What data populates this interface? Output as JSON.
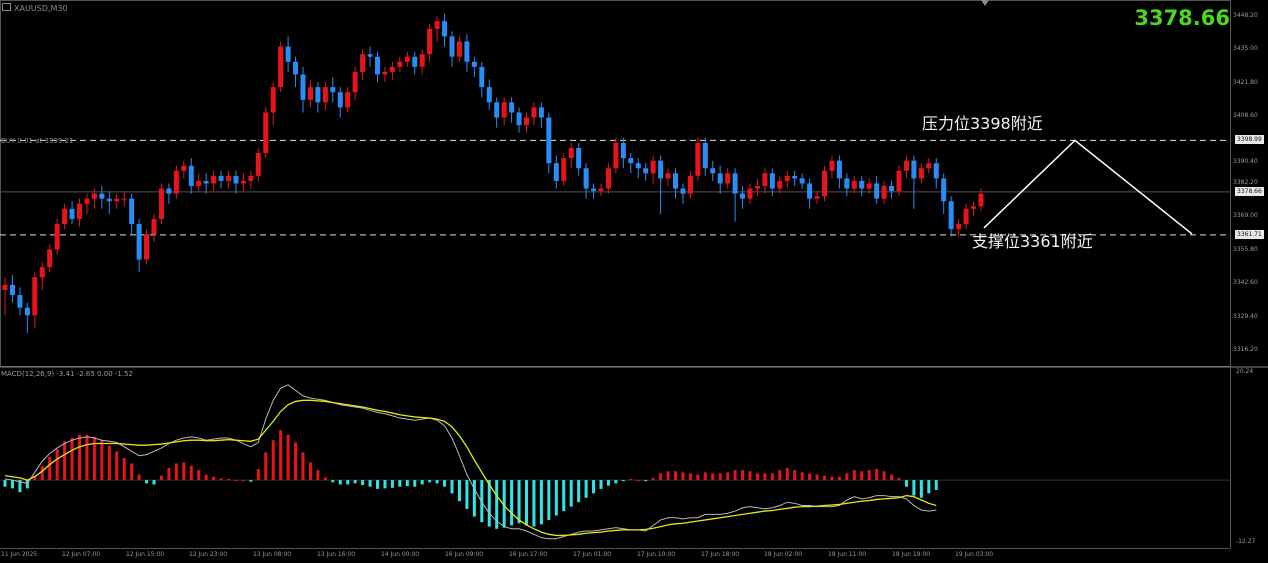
{
  "header": {
    "symbol_label": "XAUUSD,M30",
    "last_price_big": "3378.66"
  },
  "order_label": "BUY 0.01 at 3399.21",
  "annotations": {
    "resistance": "压力位3398附近",
    "support": "支撑位3361附近"
  },
  "macd_label": "MACD(12,26,9) -3.41 -2.65 0.00 -1.52",
  "colors": {
    "background": "#000000",
    "bull": "#e8141c",
    "bear": "#2a8cf5",
    "macd_pos": "#e8141c",
    "macd_neg": "#2fe6e6",
    "signal": "#e6e61a",
    "macd_line": "#b8b8b8",
    "last_price": "#4cd622"
  },
  "icons": {
    "symbol": "chart-window-icon",
    "scroll_marker": "triangle-down-icon"
  },
  "price_axis": [
    "3448.20",
    "3435.00",
    "3421.80",
    "3408.60",
    "3382.20",
    "3369.00",
    "3355.80",
    "3342.60",
    "3329.40",
    "3316.20"
  ],
  "price_tags": {
    "resistance": "3398.99",
    "current": "3378.66",
    "support": "3361.71",
    "order": "3390.40"
  },
  "macd_axis": [
    "20.24",
    "-12.27"
  ],
  "time_axis": [
    "11 Jun 2025",
    "12 Jun 07:00",
    "12 Jun 15:00",
    "12 Jun 23:00",
    "13 Jun 08:00",
    "13 Jun 16:00",
    "14 Jun 00:00",
    "16 Jun 09:00",
    "16 Jun 17:00",
    "17 Jun 01:00",
    "17 Jun 10:00",
    "17 Jun 18:00",
    "18 Jun 02:00",
    "18 Jun 11:00",
    "18 Jun 19:00",
    "19 Jun 03:00"
  ],
  "chart_data": {
    "type": "candlestick",
    "price_ylim": [
      3310,
      3452
    ],
    "macd_ylim": [
      -12.27,
      20.24
    ],
    "levels": {
      "resistance": 3398.99,
      "support": 3361.71,
      "current": 3378.66
    },
    "candles": [
      [
        3340,
        3342,
        3330,
        3345
      ],
      [
        3342,
        3338,
        3335,
        3346
      ],
      [
        3338,
        3333,
        3330,
        3341
      ],
      [
        3333,
        3330,
        3323,
        3335
      ],
      [
        3330,
        3345,
        3325,
        3347
      ],
      [
        3345,
        3349,
        3340,
        3351
      ],
      [
        3349,
        3356,
        3347,
        3358
      ],
      [
        3356,
        3366,
        3354,
        3368
      ],
      [
        3366,
        3372,
        3364,
        3374
      ],
      [
        3372,
        3368,
        3366,
        3375
      ],
      [
        3368,
        3374,
        3365,
        3376
      ],
      [
        3374,
        3376,
        3370,
        3378
      ],
      [
        3376,
        3378,
        3372,
        3380
      ],
      [
        3378,
        3376,
        3372,
        3381
      ],
      [
        3376,
        3375,
        3370,
        3379
      ],
      [
        3375,
        3376,
        3372,
        3378
      ],
      [
        3376,
        3376,
        3373,
        3379
      ],
      [
        3376,
        3366,
        3362,
        3378
      ],
      [
        3366,
        3352,
        3347,
        3368
      ],
      [
        3352,
        3362,
        3350,
        3364
      ],
      [
        3362,
        3368,
        3359,
        3370
      ],
      [
        3368,
        3380,
        3366,
        3382
      ],
      [
        3380,
        3378,
        3374,
        3382
      ],
      [
        3378,
        3387,
        3376,
        3389
      ],
      [
        3387,
        3389,
        3384,
        3391
      ],
      [
        3389,
        3381,
        3378,
        3392
      ],
      [
        3381,
        3383,
        3379,
        3386
      ],
      [
        3383,
        3382,
        3378,
        3386
      ],
      [
        3382,
        3385,
        3379,
        3387
      ],
      [
        3385,
        3383,
        3380,
        3387
      ],
      [
        3383,
        3385,
        3380,
        3387
      ],
      [
        3385,
        3382,
        3378,
        3387
      ],
      [
        3382,
        3383,
        3379,
        3386
      ],
      [
        3383,
        3385,
        3380,
        3387
      ],
      [
        3385,
        3394,
        3383,
        3396
      ],
      [
        3394,
        3410,
        3392,
        3412
      ],
      [
        3410,
        3420,
        3405,
        3422
      ],
      [
        3420,
        3436,
        3418,
        3438
      ],
      [
        3436,
        3430,
        3426,
        3440
      ],
      [
        3430,
        3425,
        3420,
        3432
      ],
      [
        3425,
        3415,
        3410,
        3428
      ],
      [
        3415,
        3420,
        3412,
        3423
      ],
      [
        3420,
        3414,
        3410,
        3422
      ],
      [
        3414,
        3420,
        3411,
        3422
      ],
      [
        3420,
        3418,
        3414,
        3424
      ],
      [
        3418,
        3412,
        3408,
        3420
      ],
      [
        3412,
        3418,
        3410,
        3420
      ],
      [
        3418,
        3426,
        3415,
        3428
      ],
      [
        3426,
        3433,
        3423,
        3435
      ],
      [
        3433,
        3432,
        3428,
        3436
      ],
      [
        3432,
        3425,
        3422,
        3434
      ],
      [
        3425,
        3426,
        3422,
        3428
      ],
      [
        3426,
        3428,
        3423,
        3430
      ],
      [
        3428,
        3430,
        3426,
        3432
      ],
      [
        3430,
        3432,
        3428,
        3434
      ],
      [
        3432,
        3428,
        3425,
        3434
      ],
      [
        3428,
        3433,
        3425,
        3435
      ],
      [
        3433,
        3443,
        3430,
        3445
      ],
      [
        3443,
        3446,
        3438,
        3448
      ],
      [
        3446,
        3440,
        3436,
        3449
      ],
      [
        3440,
        3432,
        3428,
        3442
      ],
      [
        3432,
        3438,
        3430,
        3440
      ],
      [
        3438,
        3430,
        3426,
        3441
      ],
      [
        3430,
        3428,
        3424,
        3432
      ],
      [
        3428,
        3420,
        3416,
        3430
      ],
      [
        3420,
        3414,
        3411,
        3423
      ],
      [
        3414,
        3408,
        3404,
        3416
      ],
      [
        3408,
        3414,
        3405,
        3416
      ],
      [
        3414,
        3410,
        3406,
        3416
      ],
      [
        3410,
        3405,
        3402,
        3412
      ],
      [
        3405,
        3408,
        3402,
        3410
      ],
      [
        3408,
        3412,
        3405,
        3414
      ],
      [
        3412,
        3408,
        3404,
        3414
      ],
      [
        3408,
        3390,
        3386,
        3410
      ],
      [
        3390,
        3383,
        3380,
        3393
      ],
      [
        3383,
        3392,
        3381,
        3394
      ],
      [
        3392,
        3396,
        3388,
        3398
      ],
      [
        3396,
        3388,
        3385,
        3398
      ],
      [
        3388,
        3380,
        3376,
        3390
      ],
      [
        3380,
        3379,
        3376,
        3382
      ],
      [
        3379,
        3380,
        3377,
        3382
      ],
      [
        3380,
        3388,
        3378,
        3390
      ],
      [
        3388,
        3398,
        3386,
        3400
      ],
      [
        3398,
        3392,
        3388,
        3400
      ],
      [
        3392,
        3390,
        3386,
        3394
      ],
      [
        3390,
        3388,
        3384,
        3392
      ],
      [
        3388,
        3386,
        3383,
        3390
      ],
      [
        3386,
        3391,
        3382,
        3393
      ],
      [
        3391,
        3384,
        3370,
        3393
      ],
      [
        3384,
        3386,
        3381,
        3388
      ],
      [
        3386,
        3380,
        3376,
        3388
      ],
      [
        3380,
        3378,
        3374,
        3382
      ],
      [
        3378,
        3385,
        3376,
        3387
      ],
      [
        3385,
        3398,
        3383,
        3400
      ],
      [
        3398,
        3388,
        3385,
        3400
      ],
      [
        3388,
        3386,
        3383,
        3391
      ],
      [
        3386,
        3382,
        3378,
        3389
      ],
      [
        3382,
        3386,
        3380,
        3388
      ],
      [
        3386,
        3378,
        3367,
        3388
      ],
      [
        3378,
        3376,
        3372,
        3381
      ],
      [
        3376,
        3380,
        3374,
        3382
      ],
      [
        3380,
        3381,
        3377,
        3384
      ],
      [
        3381,
        3386,
        3378,
        3388
      ],
      [
        3386,
        3380,
        3377,
        3388
      ],
      [
        3380,
        3383,
        3378,
        3385
      ],
      [
        3383,
        3385,
        3380,
        3387
      ],
      [
        3385,
        3384,
        3381,
        3387
      ],
      [
        3384,
        3382,
        3380,
        3386
      ],
      [
        3382,
        3376,
        3372,
        3384
      ],
      [
        3376,
        3377,
        3374,
        3379
      ],
      [
        3377,
        3387,
        3375,
        3389
      ],
      [
        3387,
        3391,
        3384,
        3393
      ],
      [
        3391,
        3384,
        3380,
        3393
      ],
      [
        3384,
        3380,
        3377,
        3386
      ],
      [
        3380,
        3383,
        3378,
        3385
      ],
      [
        3383,
        3380,
        3377,
        3385
      ],
      [
        3380,
        3382,
        3378,
        3384
      ],
      [
        3382,
        3376,
        3374,
        3385
      ],
      [
        3376,
        3381,
        3374,
        3383
      ],
      [
        3381,
        3379,
        3376,
        3383
      ],
      [
        3379,
        3387,
        3377,
        3389
      ],
      [
        3387,
        3391,
        3384,
        3393
      ],
      [
        3391,
        3384,
        3372,
        3393
      ],
      [
        3384,
        3388,
        3382,
        3390
      ],
      [
        3388,
        3390,
        3386,
        3392
      ],
      [
        3390,
        3384,
        3380,
        3392
      ],
      [
        3384,
        3375,
        3370,
        3386
      ],
      [
        3375,
        3364,
        3361,
        3377
      ],
      [
        3364,
        3366,
        3361,
        3368
      ],
      [
        3366,
        3372,
        3364,
        3374
      ],
      [
        3372,
        3373,
        3369,
        3375
      ],
      [
        3373,
        3378,
        3371,
        3380
      ]
    ],
    "macd": [
      -1.2,
      -1.5,
      -2.2,
      -1.5,
      0.8,
      2.5,
      4.2,
      5.6,
      7.0,
      7.6,
      8.2,
      8.2,
      7.8,
      7.2,
      6.2,
      5.2,
      4.0,
      3.0,
      1.0,
      -0.6,
      -0.8,
      0.8,
      2.2,
      3.0,
      3.2,
      2.6,
      1.8,
      1.0,
      0.6,
      0.3,
      0.2,
      0.0,
      0.0,
      -0.3,
      2.0,
      5.0,
      7.2,
      9.0,
      8.2,
      6.8,
      5.0,
      3.2,
      1.8,
      0.5,
      -0.4,
      -0.8,
      -0.8,
      -0.6,
      -0.9,
      -1.2,
      -1.6,
      -1.5,
      -1.4,
      -1.2,
      -1.1,
      -1.2,
      -0.8,
      -0.4,
      -0.6,
      -1.2,
      -2.4,
      -3.8,
      -5.2,
      -6.6,
      -7.6,
      -8.4,
      -8.8,
      -8.6,
      -8.2,
      -7.8,
      -8.2,
      -8.4,
      -8.0,
      -7.2,
      -6.4,
      -5.6,
      -4.8,
      -4.0,
      -3.2,
      -2.4,
      -1.6,
      -1.0,
      -0.6,
      -0.2,
      0.2,
      0.0,
      -0.2,
      0.4,
      1.2,
      1.6,
      1.6,
      1.4,
      1.2,
      1.0,
      1.4,
      1.2,
      1.2,
      1.4,
      1.8,
      1.8,
      1.6,
      1.2,
      1.2,
      1.2,
      1.8,
      2.2,
      1.8,
      1.4,
      1.2,
      1.0,
      0.8,
      0.6,
      0.6,
      1.2,
      1.8,
      1.6,
      1.8,
      2.0,
      1.6,
      1.0,
      0.4,
      -1.2,
      -2.8,
      -3.2,
      -2.4,
      -1.8
    ],
    "macd_main": [
      0.2,
      0.0,
      -0.3,
      -0.6,
      1.4,
      3.4,
      4.8,
      5.8,
      6.6,
      7.2,
      7.6,
      7.8,
      7.6,
      7.2,
      7.0,
      6.8,
      6.0,
      5.2,
      4.4,
      4.6,
      5.2,
      5.8,
      6.6,
      7.2,
      7.6,
      7.8,
      7.6,
      7.2,
      7.4,
      7.6,
      7.6,
      7.2,
      6.6,
      6.0,
      6.8,
      11.0,
      14.4,
      16.6,
      17.2,
      16.2,
      15.2,
      14.8,
      14.6,
      14.4,
      14.0,
      13.6,
      13.4,
      13.2,
      13.0,
      12.6,
      12.2,
      12.0,
      11.6,
      11.2,
      11.0,
      10.8,
      11.0,
      11.2,
      10.8,
      9.8,
      7.6,
      4.4,
      1.0,
      -1.6,
      -4.0,
      -6.0,
      -7.4,
      -8.4,
      -8.8,
      -8.8,
      -9.2,
      -9.8,
      -10.4,
      -10.6,
      -10.6,
      -10.2,
      -9.8,
      -9.4,
      -9.2,
      -9.2,
      -9.0,
      -8.8,
      -8.6,
      -8.8,
      -9.0,
      -9.0,
      -9.2,
      -8.2,
      -7.2,
      -6.8,
      -6.8,
      -7.0,
      -6.8,
      -6.8,
      -6.2,
      -6.2,
      -6.2,
      -6.0,
      -5.6,
      -5.0,
      -4.8,
      -5.0,
      -5.2,
      -5.0,
      -4.6,
      -4.0,
      -4.2,
      -4.6,
      -4.6,
      -4.8,
      -4.8,
      -4.8,
      -4.6,
      -3.6,
      -3.0,
      -3.4,
      -3.2,
      -2.8,
      -2.8,
      -3.0,
      -3.0,
      -3.4,
      -4.6,
      -5.4,
      -5.6,
      -5.4
    ],
    "macd_signal": [
      0.8,
      0.6,
      0.4,
      0.0,
      0.6,
      1.6,
      2.8,
      3.8,
      4.6,
      5.4,
      6.0,
      6.4,
      6.6,
      6.6,
      6.6,
      6.6,
      6.5,
      6.4,
      6.3,
      6.3,
      6.4,
      6.5,
      6.7,
      6.9,
      7.1,
      7.2,
      7.2,
      7.1,
      7.1,
      7.2,
      7.3,
      7.2,
      7.1,
      7.0,
      7.4,
      9.0,
      10.6,
      12.4,
      13.6,
      14.2,
      14.4,
      14.4,
      14.3,
      14.2,
      14.0,
      13.8,
      13.6,
      13.4,
      13.2,
      12.9,
      12.6,
      12.4,
      12.1,
      11.8,
      11.6,
      11.4,
      11.3,
      11.2,
      11.0,
      10.6,
      9.6,
      8.0,
      6.0,
      3.6,
      1.4,
      -0.8,
      -2.8,
      -4.6,
      -6.0,
      -7.2,
      -8.1,
      -8.8,
      -9.4,
      -9.8,
      -10.0,
      -10.0,
      -9.9,
      -9.8,
      -9.6,
      -9.5,
      -9.4,
      -9.2,
      -9.1,
      -9.0,
      -9.0,
      -9.0,
      -8.9,
      -8.7,
      -8.4,
      -8.1,
      -7.9,
      -7.8,
      -7.6,
      -7.4,
      -7.2,
      -7.0,
      -6.8,
      -6.6,
      -6.4,
      -6.2,
      -6.0,
      -5.8,
      -5.6,
      -5.5,
      -5.3,
      -5.1,
      -4.9,
      -4.8,
      -4.8,
      -4.7,
      -4.6,
      -4.5,
      -4.4,
      -4.2,
      -4.0,
      -3.8,
      -3.7,
      -3.5,
      -3.4,
      -3.3,
      -3.2,
      -2.8,
      -3.0,
      -3.6,
      -4.2,
      -4.6
    ]
  }
}
